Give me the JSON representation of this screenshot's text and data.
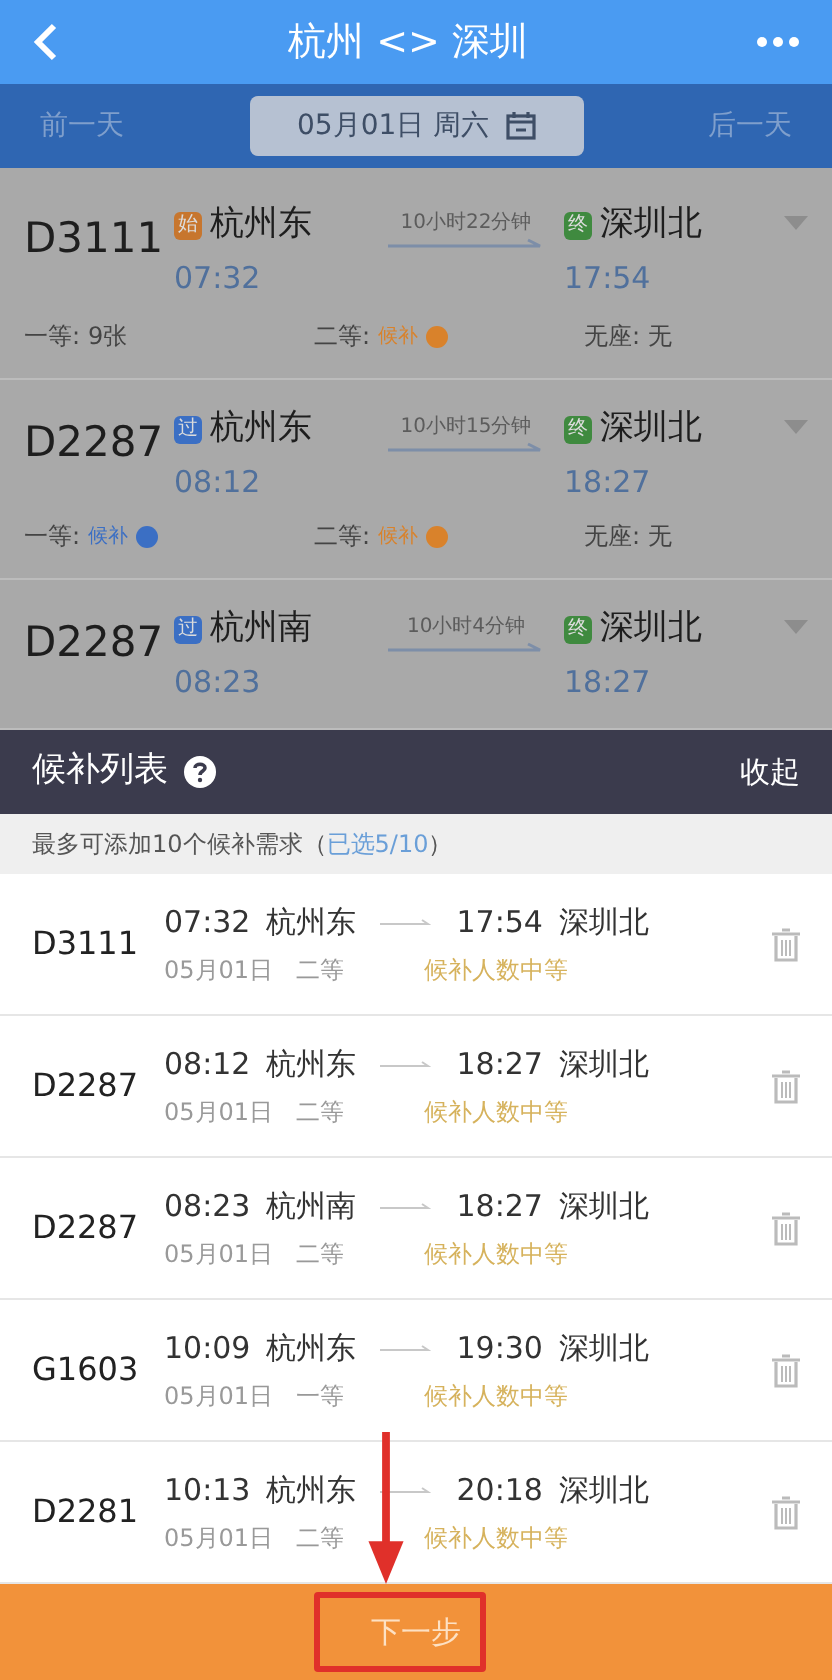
{
  "header": {
    "title": "杭州 <> 深圳"
  },
  "date_bar": {
    "prev": "前一天",
    "date": "05月01日 周六",
    "next": "后一天"
  },
  "trains": [
    {
      "number": "D3111",
      "from_station": "杭州东",
      "from_badge": {
        "text": "始",
        "color": "#c7762e"
      },
      "depart": "07:32",
      "duration": "10小时22分钟",
      "to_station": "深圳北",
      "to_badge": {
        "text": "终",
        "color": "#3f8a3f"
      },
      "arrive": "17:54",
      "seats": [
        {
          "label": "一等:",
          "value": "9张",
          "kind": "text"
        },
        {
          "label": "二等:",
          "value": "候补",
          "kind": "waitlist",
          "color": "#d9822b"
        },
        {
          "label": "无座:",
          "value": "无",
          "kind": "text"
        }
      ]
    },
    {
      "number": "D2287",
      "from_station": "杭州东",
      "from_badge": {
        "text": "过",
        "color": "#3b6fc4"
      },
      "depart": "08:12",
      "duration": "10小时15分钟",
      "to_station": "深圳北",
      "to_badge": {
        "text": "终",
        "color": "#3f8a3f"
      },
      "arrive": "18:27",
      "seats": [
        {
          "label": "一等:",
          "value": "候补",
          "kind": "waitlist",
          "color": "#3b6fc4"
        },
        {
          "label": "二等:",
          "value": "候补",
          "kind": "waitlist",
          "color": "#d9822b"
        },
        {
          "label": "无座:",
          "value": "无",
          "kind": "text"
        }
      ]
    },
    {
      "number": "D2287",
      "from_station": "杭州南",
      "from_badge": {
        "text": "过",
        "color": "#3b6fc4"
      },
      "depart": "08:23",
      "duration": "10小时4分钟",
      "to_station": "深圳北",
      "to_badge": {
        "text": "终",
        "color": "#3f8a3f"
      },
      "arrive": "18:27"
    }
  ],
  "waitlist_panel": {
    "title": "候补列表",
    "collapse": "收起",
    "hint": "最多可添加10个候补需求（",
    "selected_count": "已选5/10",
    "hint_end": "）",
    "items": [
      {
        "train": "D3111",
        "depart": "07:32",
        "from": "杭州东",
        "arrive": "17:54",
        "to": "深圳北",
        "date": "05月01日",
        "seat_class": "二等",
        "status": "候补人数中等"
      },
      {
        "train": "D2287",
        "depart": "08:12",
        "from": "杭州东",
        "arrive": "18:27",
        "to": "深圳北",
        "date": "05月01日",
        "seat_class": "二等",
        "status": "候补人数中等"
      },
      {
        "train": "D2287",
        "depart": "08:23",
        "from": "杭州南",
        "arrive": "18:27",
        "to": "深圳北",
        "date": "05月01日",
        "seat_class": "二等",
        "status": "候补人数中等"
      },
      {
        "train": "G1603",
        "depart": "10:09",
        "from": "杭州东",
        "arrive": "19:30",
        "to": "深圳北",
        "date": "05月01日",
        "seat_class": "一等",
        "status": "候补人数中等"
      },
      {
        "train": "D2281",
        "depart": "10:13",
        "from": "杭州东",
        "arrive": "20:18",
        "to": "深圳北",
        "date": "05月01日",
        "seat_class": "二等",
        "status": "候补人数中等"
      }
    ]
  },
  "next_button": "下一步"
}
